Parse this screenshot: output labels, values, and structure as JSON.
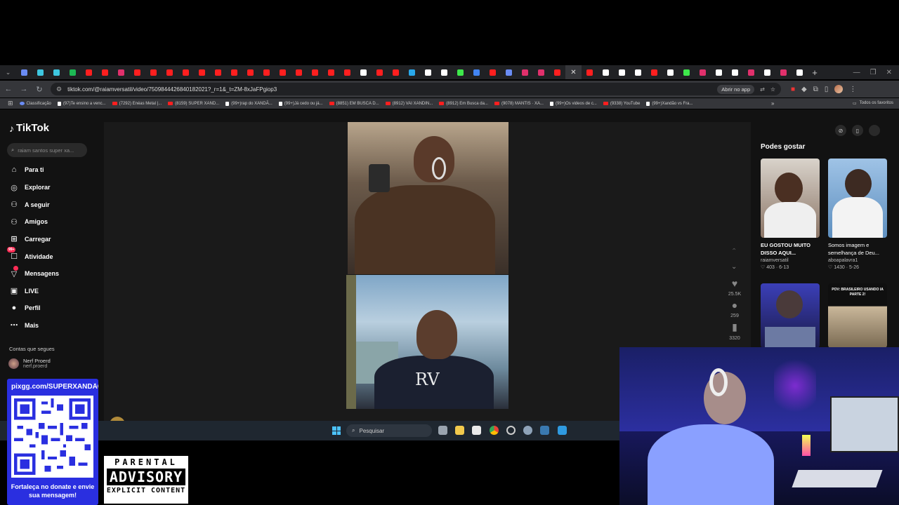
{
  "browser": {
    "tab_colors": [
      "#6a8cf5",
      "#3ec7e0",
      "#3ec7e0",
      "#1db954",
      "#ff1f1f",
      "#ff1f1f",
      "#e1306c",
      "#ff1f1f",
      "#ff1f1f",
      "#ff1f1f",
      "#ff1f1f",
      "#ff1f1f",
      "#ff1f1f",
      "#ff1f1f",
      "#ff1f1f",
      "#ff1f1f",
      "#ff1f1f",
      "#ff1f1f",
      "#ff1f1f",
      "#ff1f1f",
      "#ff1f1f",
      "#ffffff",
      "#ff1f1f",
      "#ff1f1f",
      "#29a8eb",
      "#ffffff",
      "#ffffff",
      "#3ee84b",
      "#4285f4",
      "#ff1f1f",
      "#6a8cf5",
      "#e1306c",
      "#e1306c",
      "#ff1f1f"
    ],
    "tab_colors_right": [
      "#ff1f1f",
      "#ffffff",
      "#ffffff",
      "#ffffff",
      "#ff1f1f",
      "#ffffff",
      "#3ee84b",
      "#e1306c",
      "#ffffff",
      "#ffffff",
      "#e1306c",
      "#ffffff",
      "#e1306c",
      "#ffffff"
    ],
    "url": "tiktok.com/@raiamversatil/video/7509844426840182021?_r=1&_t=ZM-8xJaFPgiop3",
    "open_in_app": "Abrir no app",
    "bookmarks": [
      {
        "label": "Classificação",
        "kind": "g"
      },
      {
        "label": "(97)Te ensino a venc...",
        "kind": "t"
      },
      {
        "label": "(7292) Enéas Metal |...",
        "kind": "y"
      },
      {
        "label": "(8159) SUPER XAND...",
        "kind": "y"
      },
      {
        "label": "(99+)rap do XANDÃ...",
        "kind": "t"
      },
      {
        "label": "(99+)Já cedo ou já...",
        "kind": "t"
      },
      {
        "label": "(8851) EM BUSCA D...",
        "kind": "y"
      },
      {
        "label": "(8912) VAI XANDIN...",
        "kind": "y"
      },
      {
        "label": "(8912) Em Busca da...",
        "kind": "y"
      },
      {
        "label": "(9078) MANTIS · XA...",
        "kind": "y"
      },
      {
        "label": "(99+)Os videos de c...",
        "kind": "t"
      },
      {
        "label": "(9338) YouTube",
        "kind": "y"
      },
      {
        "label": "(99+)Xandão vs Fra...",
        "kind": "t"
      }
    ],
    "all_favorites": "Todos os favoritos"
  },
  "tiktok": {
    "logo": "TikTok",
    "search_placeholder": "raiam santos super xa...",
    "nav": [
      {
        "label": "Para ti",
        "icon": "home-icon",
        "glyph": "⌂"
      },
      {
        "label": "Explorar",
        "icon": "compass-icon",
        "glyph": "◎"
      },
      {
        "label": "A seguir",
        "icon": "follow-icon",
        "glyph": "⚇"
      },
      {
        "label": "Amigos",
        "icon": "friends-icon",
        "glyph": "⚇"
      },
      {
        "label": "Carregar",
        "icon": "upload-icon",
        "glyph": "⊞"
      },
      {
        "label": "Atividade",
        "icon": "activity-icon",
        "glyph": "☐",
        "badge": "99+"
      },
      {
        "label": "Mensagens",
        "icon": "messages-icon",
        "glyph": "▽",
        "badge": "1"
      },
      {
        "label": "LIVE",
        "icon": "live-icon",
        "glyph": "▣"
      },
      {
        "label": "Perfil",
        "icon": "profile-icon",
        "glyph": "●"
      },
      {
        "label": "Mais",
        "icon": "more-icon",
        "glyph": "⋯"
      }
    ],
    "following_heading": "Contas que segues",
    "following_account": {
      "name": "Nerf Proerd",
      "handle": "nerf.proerd"
    },
    "video_watermark": "RV",
    "actions": {
      "likes": "25.5K",
      "comments": "259",
      "saves": "3320"
    },
    "author": "raiamversatil",
    "recommend_heading": "Podes gostar",
    "cards": [
      {
        "title": "EU GOSTOU MUITO DISSO AQUI...",
        "author": "raiamversatil",
        "likes": "403",
        "date": "6-13"
      },
      {
        "title": "Somos imagem e semelhança de Deu...",
        "author": "aboapalavra1",
        "likes": "1430",
        "date": "5-26"
      },
      {
        "title": "",
        "author": "",
        "likes": "",
        "date": ""
      },
      {
        "title": "POV: BRASILEIRO USANDO IA PARTE 2!",
        "author": "",
        "likes": "",
        "date": ""
      }
    ]
  },
  "taskbar": {
    "search_label": "Pesquisar"
  },
  "overlay": {
    "qr_url": "pixgg.com/SUPERXANDÃO",
    "qr_caption": "Fortaleça no donate e envie sua mensagem!",
    "advisory": {
      "line1": "PARENTAL",
      "line2": "ADVISORY",
      "line3": "EXPLICIT CONTENT"
    }
  }
}
